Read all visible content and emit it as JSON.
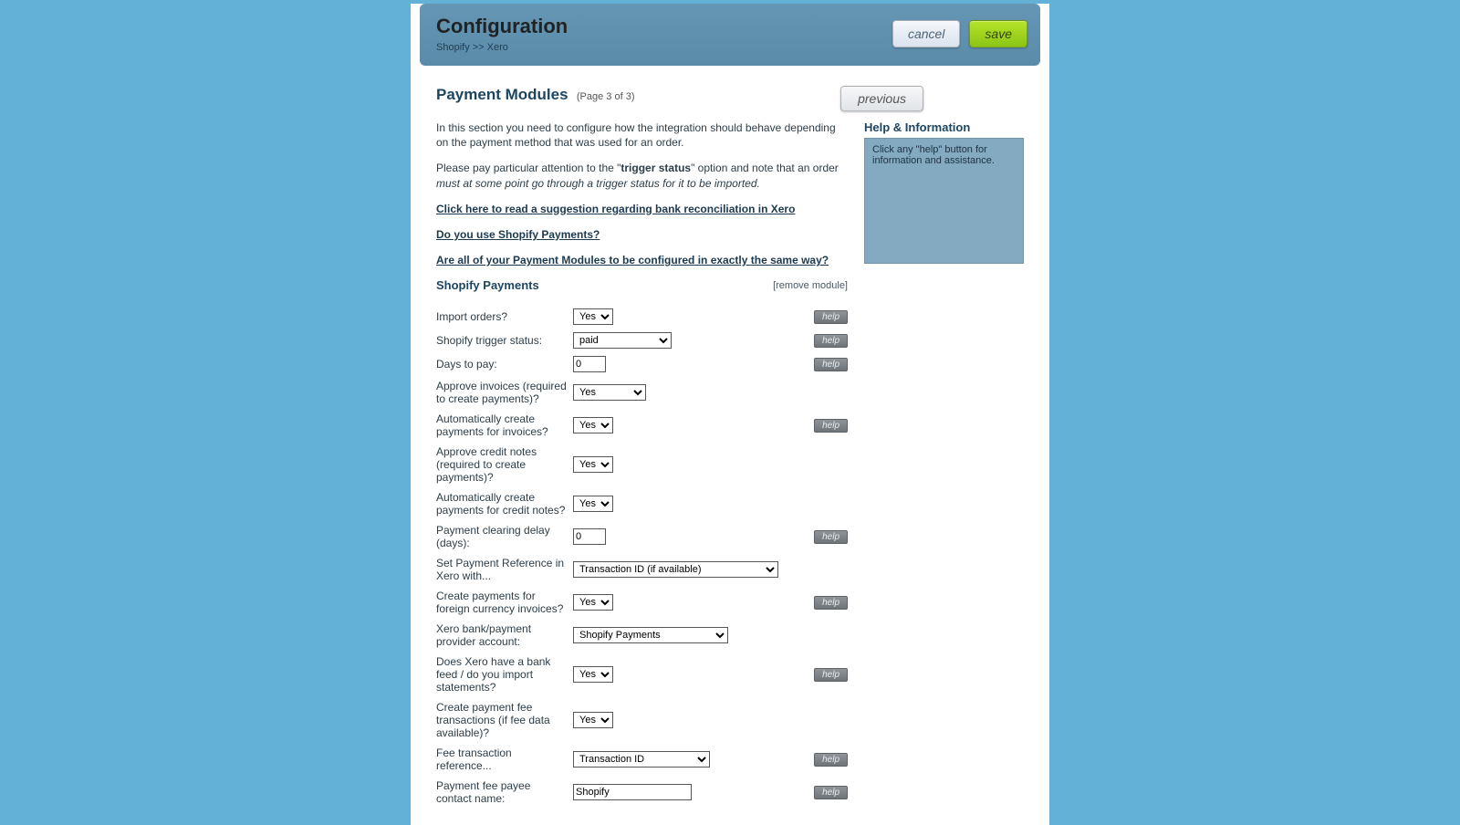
{
  "header": {
    "title": "Configuration",
    "breadcrumb": "Shopify >> Xero",
    "cancel": "cancel",
    "save": "save"
  },
  "section": {
    "heading": "Payment Modules",
    "page_indicator": "(Page 3 of 3)",
    "previous": "previous"
  },
  "intro": {
    "p1": "In this section you need to configure how the integration should behave depending on the payment method that was used for an order.",
    "p2a": "Please pay particular attention to the \"",
    "p2b": "trigger status",
    "p2c": "\" option and note that an order ",
    "p2d": "must at some point go through a trigger status for it to be imported.",
    "link1": "Click here to read a suggestion regarding bank reconciliation in Xero",
    "link2": "Do you use Shopify Payments?",
    "link3": "Are all of your Payment Modules to be configured in exactly the same way?"
  },
  "helpInfo": {
    "title": "Help & Information",
    "body": "Click any \"help\" button for information and assistance."
  },
  "module": {
    "title": "Shopify Payments",
    "remove": "[remove module]"
  },
  "helpLabel": "help",
  "fields": {
    "import_orders": {
      "label": "Import orders?",
      "value": "Yes",
      "help": true
    },
    "trigger_status": {
      "label": "Shopify trigger status:",
      "value": "paid",
      "help": true
    },
    "days_to_pay": {
      "label": "Days to pay:",
      "value": "0",
      "help": true
    },
    "approve_invoices": {
      "label": "Approve invoices (required to create payments)?",
      "value": "Yes",
      "help": false
    },
    "auto_pay_invoices": {
      "label": "Automatically create payments for invoices?",
      "value": "Yes",
      "help": true
    },
    "approve_credit": {
      "label": "Approve credit notes (required to create payments)?",
      "value": "Yes",
      "help": false
    },
    "auto_pay_credit": {
      "label": "Automatically create payments for credit notes?",
      "value": "Yes",
      "help": false
    },
    "clearing_delay": {
      "label": "Payment clearing delay (days):",
      "value": "0",
      "help": true
    },
    "pay_ref": {
      "label": "Set Payment Reference in Xero with...",
      "value": "Transaction ID (if available)",
      "help": false
    },
    "foreign_currency": {
      "label": "Create payments for foreign currency invoices?",
      "value": "Yes",
      "help": true
    },
    "bank_account": {
      "label": "Xero bank/payment provider account:",
      "value": "Shopify Payments",
      "help": false
    },
    "bank_feed": {
      "label": "Does Xero have a bank feed / do you import statements?",
      "value": "Yes",
      "help": true
    },
    "fee_tx": {
      "label": "Create payment fee transactions (if fee data available)?",
      "value": "Yes",
      "help": false
    },
    "fee_ref": {
      "label": "Fee transaction reference...",
      "value": "Transaction ID",
      "help": true
    },
    "fee_payee": {
      "label": "Payment fee payee contact name:",
      "value": "Shopify",
      "help": true
    }
  }
}
